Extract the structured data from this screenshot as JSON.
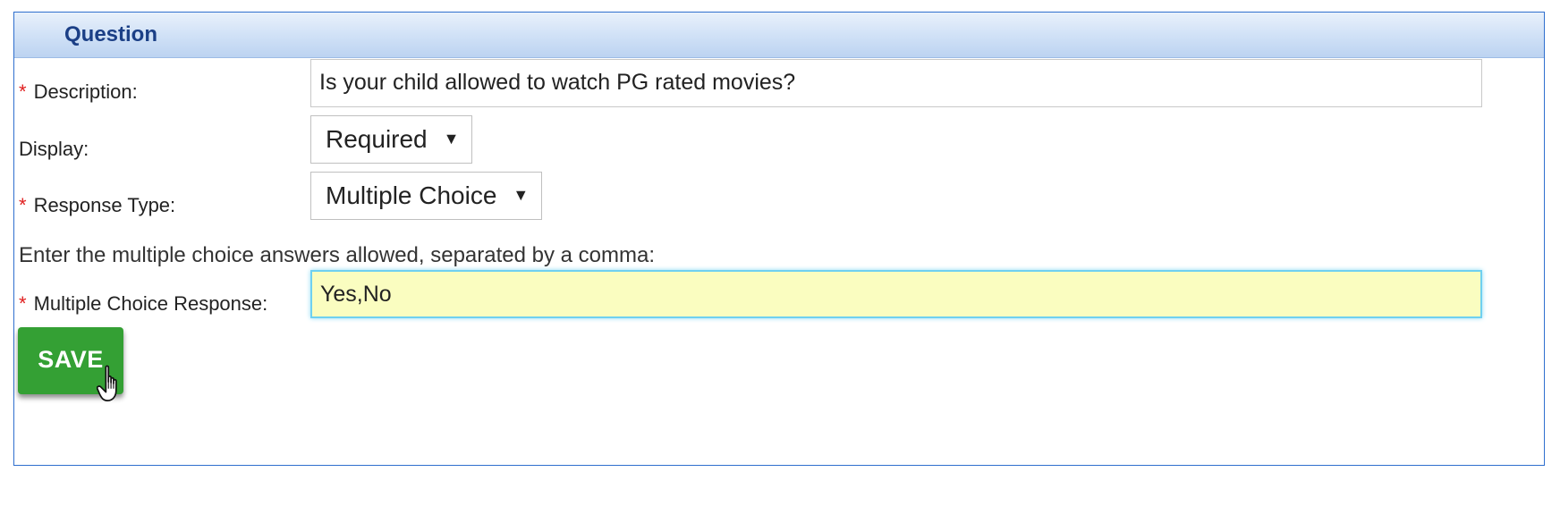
{
  "panel": {
    "title": "Question"
  },
  "form": {
    "required_marker": "*",
    "description": {
      "label": "Description:",
      "value": "Is your child allowed to watch PG rated movies?"
    },
    "display": {
      "label": "Display:",
      "selected": "Required"
    },
    "response_type": {
      "label": "Response Type:",
      "selected": "Multiple Choice"
    },
    "instruction": "Enter the multiple choice answers allowed, separated by a comma:",
    "multiple_choice_response": {
      "label": "Multiple Choice Response:",
      "value": "Yes,No"
    },
    "save_label": "SAVE"
  },
  "icons": {
    "caret": "▼",
    "cursor": "hand-pointer-icon"
  },
  "colors": {
    "header_text": "#1b3f86",
    "border": "#2f6fce",
    "required": "#e02020",
    "save_button": "#34a034",
    "focused_field": "#fafdc0"
  }
}
